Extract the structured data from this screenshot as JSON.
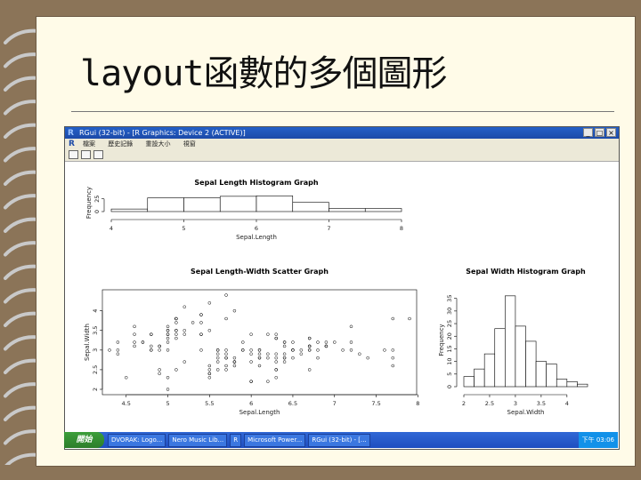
{
  "slide": {
    "title": "layout函數的多個圖形"
  },
  "window": {
    "title": "RGui (32-bit) - [R Graphics: Device 2 (ACTIVE)]",
    "menu": [
      "檔案",
      "歷史記錄",
      "重設大小",
      "視窗"
    ],
    "controls": [
      "_",
      "□",
      "×"
    ]
  },
  "taskbar": {
    "start_label": "開始",
    "items": [
      "DVORAK: Logo...",
      "Nero Music Lib...",
      "R",
      "Microsoft Power...",
      "RGui (32-bit) - [..."
    ],
    "clock": "下午 03:06"
  },
  "chart_data": [
    {
      "type": "bar",
      "title": "Sepal Length Histogram Graph",
      "xlabel": "Sepal.Length",
      "ylabel": "Frequency",
      "xticks": [
        4,
        5,
        6,
        7,
        8
      ],
      "yticks": [
        0,
        25
      ],
      "xlim": [
        4,
        8
      ],
      "ylim": [
        0,
        35
      ],
      "bins": [
        {
          "x0": 4.0,
          "x1": 4.5,
          "count": 5
        },
        {
          "x0": 4.5,
          "x1": 5.0,
          "count": 27
        },
        {
          "x0": 5.0,
          "x1": 5.5,
          "count": 27
        },
        {
          "x0": 5.5,
          "x1": 6.0,
          "count": 30
        },
        {
          "x0": 6.0,
          "x1": 6.5,
          "count": 31
        },
        {
          "x0": 6.5,
          "x1": 7.0,
          "count": 18
        },
        {
          "x0": 7.0,
          "x1": 7.5,
          "count": 6
        },
        {
          "x0": 7.5,
          "x1": 8.0,
          "count": 6
        }
      ]
    },
    {
      "type": "scatter",
      "title": "Sepal Length-Width Scatter Graph",
      "xlabel": "Sepal.Length",
      "ylabel": "Sepal.Width",
      "xticks": [
        4.5,
        5.0,
        5.5,
        6.0,
        6.5,
        7.0,
        7.5,
        8.0
      ],
      "yticks": [
        2.0,
        2.5,
        3.0,
        3.5,
        4.0
      ],
      "xlim": [
        4.3,
        7.9
      ],
      "ylim": [
        2.0,
        4.4
      ],
      "points": [
        [
          5.1,
          3.5
        ],
        [
          4.9,
          3.0
        ],
        [
          4.7,
          3.2
        ],
        [
          4.6,
          3.1
        ],
        [
          5.0,
          3.6
        ],
        [
          5.4,
          3.9
        ],
        [
          4.6,
          3.4
        ],
        [
          5.0,
          3.4
        ],
        [
          4.4,
          2.9
        ],
        [
          4.9,
          3.1
        ],
        [
          5.4,
          3.7
        ],
        [
          4.8,
          3.4
        ],
        [
          4.8,
          3.0
        ],
        [
          4.3,
          3.0
        ],
        [
          5.8,
          4.0
        ],
        [
          5.7,
          4.4
        ],
        [
          5.4,
          3.9
        ],
        [
          5.1,
          3.5
        ],
        [
          5.7,
          3.8
        ],
        [
          5.1,
          3.8
        ],
        [
          5.4,
          3.4
        ],
        [
          5.1,
          3.7
        ],
        [
          4.6,
          3.6
        ],
        [
          5.1,
          3.3
        ],
        [
          4.8,
          3.4
        ],
        [
          5.0,
          3.0
        ],
        [
          5.0,
          3.4
        ],
        [
          5.2,
          3.5
        ],
        [
          5.2,
          3.4
        ],
        [
          4.7,
          3.2
        ],
        [
          4.8,
          3.1
        ],
        [
          5.4,
          3.4
        ],
        [
          5.2,
          4.1
        ],
        [
          5.5,
          4.2
        ],
        [
          4.9,
          3.1
        ],
        [
          5.0,
          3.2
        ],
        [
          5.5,
          3.5
        ],
        [
          4.4,
          3.0
        ],
        [
          5.1,
          3.4
        ],
        [
          5.0,
          3.5
        ],
        [
          4.5,
          2.3
        ],
        [
          4.4,
          3.2
        ],
        [
          5.0,
          3.5
        ],
        [
          5.1,
          3.8
        ],
        [
          4.8,
          3.0
        ],
        [
          5.1,
          3.8
        ],
        [
          4.6,
          3.2
        ],
        [
          5.3,
          3.7
        ],
        [
          5.0,
          3.3
        ],
        [
          7.0,
          3.2
        ],
        [
          6.4,
          3.2
        ],
        [
          6.9,
          3.1
        ],
        [
          5.5,
          2.3
        ],
        [
          6.5,
          2.8
        ],
        [
          5.7,
          2.8
        ],
        [
          6.3,
          3.3
        ],
        [
          4.9,
          2.4
        ],
        [
          6.6,
          2.9
        ],
        [
          5.2,
          2.7
        ],
        [
          5.0,
          2.0
        ],
        [
          5.9,
          3.0
        ],
        [
          6.0,
          2.2
        ],
        [
          6.1,
          2.9
        ],
        [
          5.6,
          2.9
        ],
        [
          6.7,
          3.1
        ],
        [
          5.6,
          3.0
        ],
        [
          5.8,
          2.7
        ],
        [
          6.2,
          2.2
        ],
        [
          5.6,
          2.5
        ],
        [
          5.9,
          3.2
        ],
        [
          6.1,
          2.8
        ],
        [
          6.3,
          2.5
        ],
        [
          6.1,
          2.8
        ],
        [
          6.4,
          2.9
        ],
        [
          6.6,
          3.0
        ],
        [
          6.8,
          2.8
        ],
        [
          6.7,
          3.0
        ],
        [
          6.0,
          2.9
        ],
        [
          5.7,
          2.6
        ],
        [
          5.5,
          2.4
        ],
        [
          5.5,
          2.4
        ],
        [
          5.8,
          2.7
        ],
        [
          6.0,
          2.7
        ],
        [
          5.4,
          3.0
        ],
        [
          6.0,
          3.4
        ],
        [
          6.7,
          3.1
        ],
        [
          6.3,
          2.3
        ],
        [
          5.6,
          3.0
        ],
        [
          5.5,
          2.5
        ],
        [
          5.5,
          2.6
        ],
        [
          6.1,
          3.0
        ],
        [
          5.8,
          2.6
        ],
        [
          5.0,
          2.3
        ],
        [
          5.6,
          2.7
        ],
        [
          5.7,
          3.0
        ],
        [
          5.7,
          2.9
        ],
        [
          6.2,
          2.9
        ],
        [
          5.1,
          2.5
        ],
        [
          5.7,
          2.8
        ],
        [
          6.3,
          3.3
        ],
        [
          5.8,
          2.7
        ],
        [
          7.1,
          3.0
        ],
        [
          6.3,
          2.9
        ],
        [
          6.5,
          3.0
        ],
        [
          7.6,
          3.0
        ],
        [
          4.9,
          2.5
        ],
        [
          7.3,
          2.9
        ],
        [
          6.7,
          2.5
        ],
        [
          7.2,
          3.6
        ],
        [
          6.5,
          3.2
        ],
        [
          6.4,
          2.7
        ],
        [
          6.8,
          3.0
        ],
        [
          5.7,
          2.5
        ],
        [
          5.8,
          2.8
        ],
        [
          6.4,
          3.2
        ],
        [
          6.5,
          3.0
        ],
        [
          7.7,
          3.8
        ],
        [
          7.7,
          2.6
        ],
        [
          6.0,
          2.2
        ],
        [
          6.9,
          3.2
        ],
        [
          5.6,
          2.8
        ],
        [
          7.7,
          2.8
        ],
        [
          6.3,
          2.7
        ],
        [
          6.7,
          3.3
        ],
        [
          7.2,
          3.2
        ],
        [
          6.2,
          2.8
        ],
        [
          6.1,
          3.0
        ],
        [
          6.4,
          2.8
        ],
        [
          7.2,
          3.0
        ],
        [
          7.4,
          2.8
        ],
        [
          7.9,
          3.8
        ],
        [
          6.4,
          2.8
        ],
        [
          6.3,
          2.8
        ],
        [
          6.1,
          2.6
        ],
        [
          7.7,
          3.0
        ],
        [
          6.3,
          3.4
        ],
        [
          6.4,
          3.1
        ],
        [
          6.0,
          3.0
        ],
        [
          6.9,
          3.1
        ],
        [
          6.7,
          3.1
        ],
        [
          6.9,
          3.1
        ],
        [
          6.8,
          3.2
        ],
        [
          6.7,
          3.3
        ],
        [
          6.7,
          3.0
        ],
        [
          6.3,
          2.5
        ],
        [
          6.5,
          3.0
        ],
        [
          6.2,
          3.4
        ],
        [
          5.9,
          3.0
        ]
      ]
    },
    {
      "type": "bar",
      "title": "Sepal Width Histogram Graph",
      "xlabel": "Sepal.Width",
      "ylabel": "Frequency",
      "xticks": [
        2.0,
        2.5,
        3.0,
        3.5,
        4.0
      ],
      "yticks": [
        0,
        5,
        10,
        15,
        20,
        25,
        30,
        35
      ],
      "xlim": [
        2.0,
        4.4
      ],
      "ylim": [
        0,
        37
      ],
      "bins": [
        {
          "x0": 2.0,
          "x1": 2.2,
          "count": 4
        },
        {
          "x0": 2.2,
          "x1": 2.4,
          "count": 7
        },
        {
          "x0": 2.4,
          "x1": 2.6,
          "count": 13
        },
        {
          "x0": 2.6,
          "x1": 2.8,
          "count": 23
        },
        {
          "x0": 2.8,
          "x1": 3.0,
          "count": 36
        },
        {
          "x0": 3.0,
          "x1": 3.2,
          "count": 24
        },
        {
          "x0": 3.2,
          "x1": 3.4,
          "count": 18
        },
        {
          "x0": 3.4,
          "x1": 3.6,
          "count": 10
        },
        {
          "x0": 3.6,
          "x1": 3.8,
          "count": 9
        },
        {
          "x0": 3.8,
          "x1": 4.0,
          "count": 3
        },
        {
          "x0": 4.0,
          "x1": 4.2,
          "count": 2
        },
        {
          "x0": 4.2,
          "x1": 4.4,
          "count": 1
        }
      ]
    }
  ]
}
